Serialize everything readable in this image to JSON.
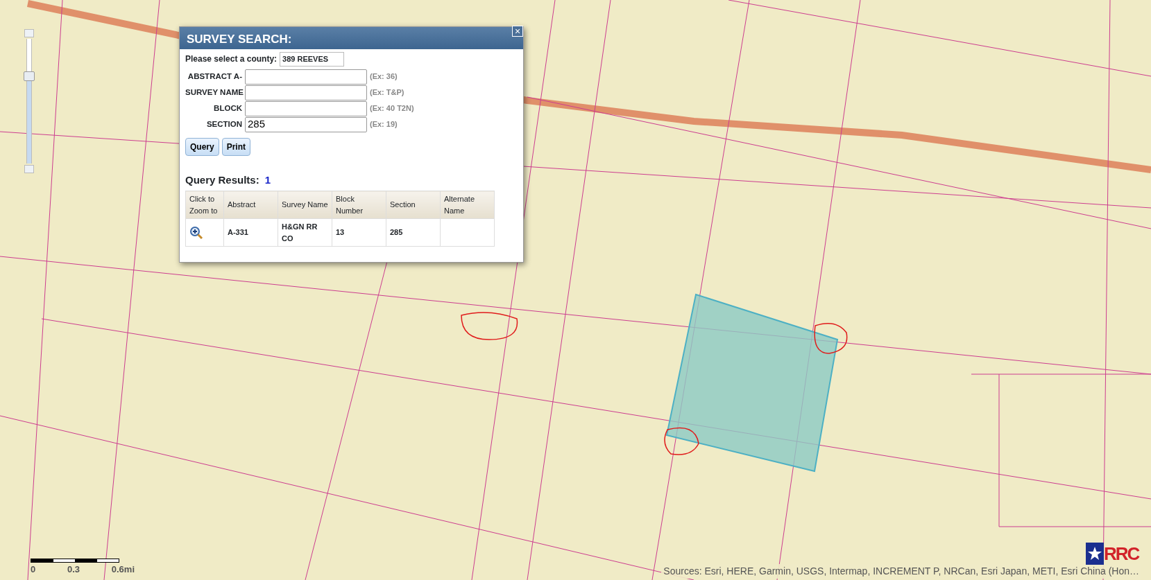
{
  "map": {
    "zoom_slider": {
      "level": 0.7
    },
    "scale_bar": {
      "labels": [
        "0",
        "0.3",
        "0.6mi"
      ]
    },
    "attribution": "Sources: Esri, HERE, Garmin, USGS, Intermap, INCREMENT P, NRCan, Esri Japan, METI, Esri China (Hon…",
    "logo": {
      "text": "RRC"
    }
  },
  "dialog": {
    "title": "SURVEY SEARCH:",
    "close": "×",
    "county": {
      "label": "Please select a county:",
      "value": "389 REEVES"
    },
    "fields": [
      {
        "label": "ABSTRACT A-",
        "hint": "(Ex: 36)"
      },
      {
        "label": "SURVEY NAME",
        "hint": "(Ex: T&P)"
      },
      {
        "label": "BLOCK",
        "hint": "(Ex: 40 T2N)"
      },
      {
        "label": "SECTION",
        "value": "285",
        "hint": "(Ex: 19)"
      }
    ],
    "buttons": [
      "Query",
      "Print"
    ],
    "results_label": "Query Results:",
    "results_count": "1",
    "table": {
      "columns": [
        "Click to Zoom to",
        "Abstract",
        "Survey Name",
        "Block Number",
        "Section",
        "Alternate Name"
      ],
      "rows": [
        [
          "",
          "A-331",
          "H&GN RR CO",
          "13",
          "285",
          ""
        ]
      ]
    }
  }
}
